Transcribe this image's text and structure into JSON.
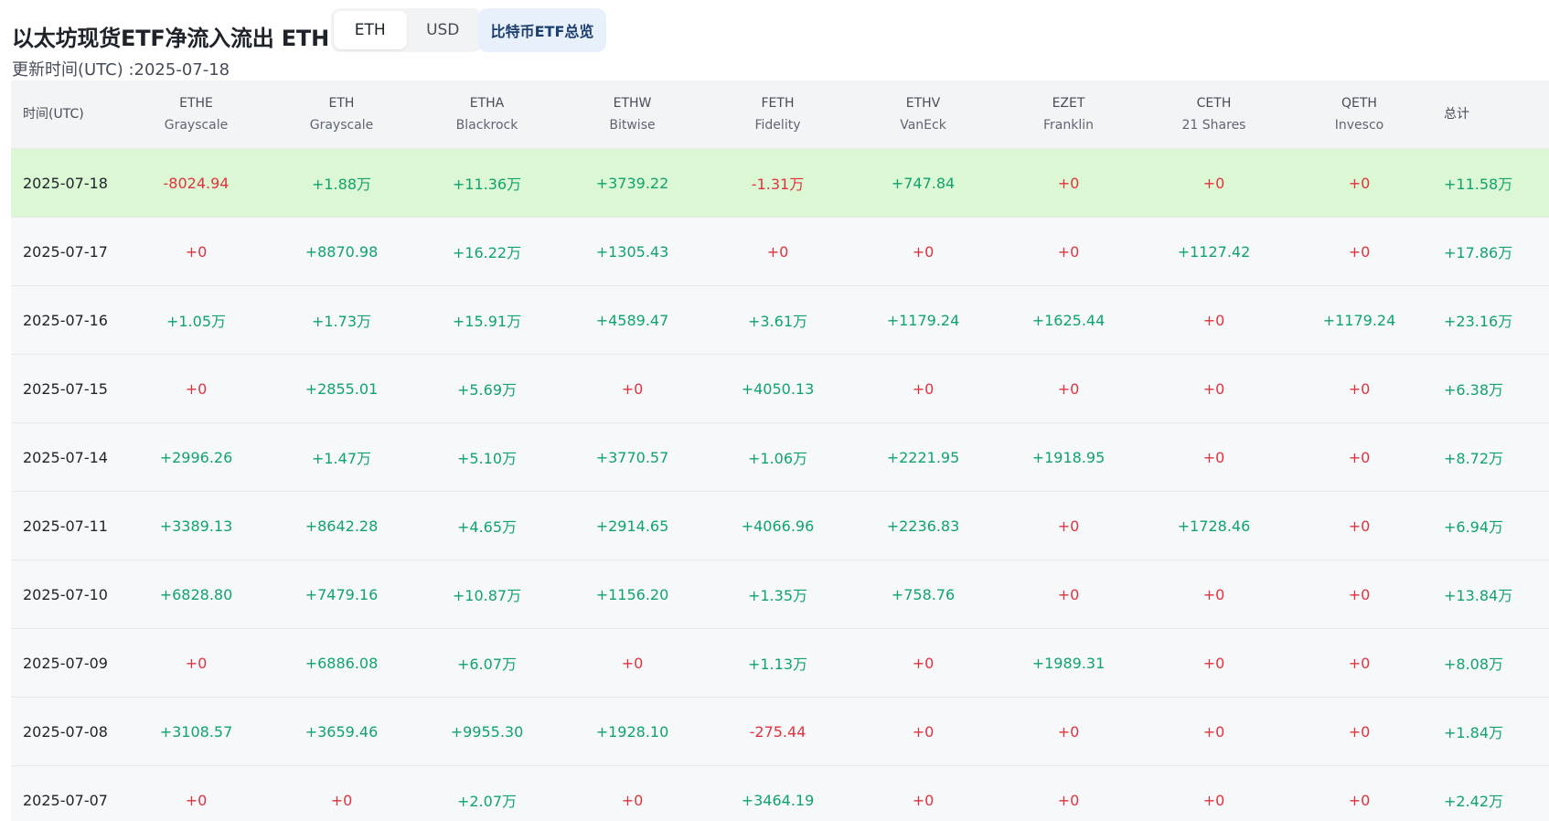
{
  "header": {
    "title": "以太坊现货ETF净流入流出 ETH",
    "updated": "更新时间(UTC) :2025-07-18",
    "unit_toggle": [
      "ETH",
      "USD"
    ],
    "unit_selected": "ETH",
    "overview_button": "比特币ETF总览"
  },
  "colors": {
    "positive": "#10a36e",
    "negative": "#e0333f",
    "highlight_row": "#dcf7d4",
    "header_bg": "#f2f4f6"
  },
  "table": {
    "first_column": "时间(UTC)",
    "total_column": "总计",
    "columns": [
      {
        "ticker": "ETHE",
        "issuer": "Grayscale"
      },
      {
        "ticker": "ETH",
        "issuer": "Grayscale"
      },
      {
        "ticker": "ETHA",
        "issuer": "Blackrock"
      },
      {
        "ticker": "ETHW",
        "issuer": "Bitwise"
      },
      {
        "ticker": "FETH",
        "issuer": "Fidelity"
      },
      {
        "ticker": "ETHV",
        "issuer": "VanEck"
      },
      {
        "ticker": "EZET",
        "issuer": "Franklin"
      },
      {
        "ticker": "CETH",
        "issuer": "21 Shares"
      },
      {
        "ticker": "QETH",
        "issuer": "Invesco"
      }
    ],
    "rows": [
      {
        "date": "2025-07-18",
        "values": [
          "-8024.94",
          "+1.88万",
          "+11.36万",
          "+3739.22",
          "-1.31万",
          "+747.84",
          "+0",
          "+0",
          "+0"
        ],
        "total": "+11.58万"
      },
      {
        "date": "2025-07-17",
        "values": [
          "+0",
          "+8870.98",
          "+16.22万",
          "+1305.43",
          "+0",
          "+0",
          "+0",
          "+1127.42",
          "+0"
        ],
        "total": "+17.86万"
      },
      {
        "date": "2025-07-16",
        "values": [
          "+1.05万",
          "+1.73万",
          "+15.91万",
          "+4589.47",
          "+3.61万",
          "+1179.24",
          "+1625.44",
          "+0",
          "+1179.24"
        ],
        "total": "+23.16万"
      },
      {
        "date": "2025-07-15",
        "values": [
          "+0",
          "+2855.01",
          "+5.69万",
          "+0",
          "+4050.13",
          "+0",
          "+0",
          "+0",
          "+0"
        ],
        "total": "+6.38万"
      },
      {
        "date": "2025-07-14",
        "values": [
          "+2996.26",
          "+1.47万",
          "+5.10万",
          "+3770.57",
          "+1.06万",
          "+2221.95",
          "+1918.95",
          "+0",
          "+0"
        ],
        "total": "+8.72万"
      },
      {
        "date": "2025-07-11",
        "values": [
          "+3389.13",
          "+8642.28",
          "+4.65万",
          "+2914.65",
          "+4066.96",
          "+2236.83",
          "+0",
          "+1728.46",
          "+0"
        ],
        "total": "+6.94万"
      },
      {
        "date": "2025-07-10",
        "values": [
          "+6828.80",
          "+7479.16",
          "+10.87万",
          "+1156.20",
          "+1.35万",
          "+758.76",
          "+0",
          "+0",
          "+0"
        ],
        "total": "+13.84万"
      },
      {
        "date": "2025-07-09",
        "values": [
          "+0",
          "+6886.08",
          "+6.07万",
          "+0",
          "+1.13万",
          "+0",
          "+1989.31",
          "+0",
          "+0"
        ],
        "total": "+8.08万"
      },
      {
        "date": "2025-07-08",
        "values": [
          "+3108.57",
          "+3659.46",
          "+9955.30",
          "+1928.10",
          "-275.44",
          "+0",
          "+0",
          "+0",
          "+0"
        ],
        "total": "+1.84万"
      },
      {
        "date": "2025-07-07",
        "values": [
          "+0",
          "+0",
          "+2.07万",
          "+0",
          "+3464.19",
          "+0",
          "+0",
          "+0",
          "+0"
        ],
        "total": "+2.42万"
      }
    ]
  }
}
